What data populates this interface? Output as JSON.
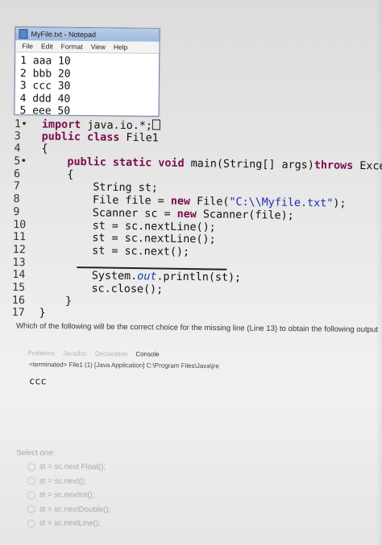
{
  "notepad": {
    "title": "MyFile.txt - Notepad",
    "menu": [
      "File",
      "Edit",
      "Format",
      "View",
      "Help"
    ],
    "lines": [
      "1 aaa 10",
      "2 bbb 20",
      "3 ccc 30",
      "4 ddd 40",
      "5 eee 50"
    ]
  },
  "editor": {
    "lines": [
      {
        "n": "1•",
        "parts": [
          {
            "t": "import",
            "c": "kw"
          },
          {
            "t": " java.io.*;"
          }
        ]
      },
      {
        "n": "3",
        "parts": [
          {
            "t": "public",
            "c": "kw"
          },
          {
            "t": " "
          },
          {
            "t": "class",
            "c": "kw"
          },
          {
            "t": " File1"
          }
        ]
      },
      {
        "n": "4",
        "parts": [
          {
            "t": "{"
          }
        ]
      },
      {
        "n": "5•",
        "parts": [
          {
            "t": "    "
          },
          {
            "t": "public",
            "c": "kw"
          },
          {
            "t": " "
          },
          {
            "t": "static",
            "c": "kw"
          },
          {
            "t": " "
          },
          {
            "t": "void",
            "c": "kw"
          },
          {
            "t": " main(String[] args)"
          },
          {
            "t": "throws",
            "c": "kw"
          },
          {
            "t": " Exception"
          }
        ]
      },
      {
        "n": "6",
        "parts": [
          {
            "t": "    {"
          }
        ]
      },
      {
        "n": "7",
        "parts": [
          {
            "t": "        String st;"
          }
        ]
      },
      {
        "n": "8",
        "parts": [
          {
            "t": "        File file = "
          },
          {
            "t": "new",
            "c": "kw"
          },
          {
            "t": " File("
          },
          {
            "t": "\"C:\\\\Myfile.txt\"",
            "c": "str"
          },
          {
            "t": ");"
          }
        ]
      },
      {
        "n": "9",
        "parts": [
          {
            "t": "        Scanner sc = "
          },
          {
            "t": "new",
            "c": "kw"
          },
          {
            "t": " Scanner(file);"
          }
        ]
      },
      {
        "n": "10",
        "parts": [
          {
            "t": "        st = sc.nextLine();"
          }
        ]
      },
      {
        "n": "11",
        "parts": [
          {
            "t": "        st = sc.nextLine();"
          }
        ]
      },
      {
        "n": "12",
        "parts": [
          {
            "t": "        st = sc.next();"
          }
        ]
      },
      {
        "n": "13",
        "parts": [],
        "missing": true
      },
      {
        "n": "14",
        "parts": [
          {
            "t": "        System."
          },
          {
            "t": "out",
            "c": "field"
          },
          {
            "t": ".println(st);"
          }
        ]
      },
      {
        "n": "15",
        "parts": [
          {
            "t": "        sc.close();"
          }
        ]
      },
      {
        "n": "16",
        "parts": [
          {
            "t": "    }"
          }
        ]
      },
      {
        "n": "17",
        "parts": [
          {
            "t": "}"
          }
        ]
      }
    ]
  },
  "question": "Which of the following will be the correct choice for the missing line (Line 13) to obtain the following output",
  "console": {
    "tabs": [
      "Problems",
      "Javadoc",
      "Declaration",
      "Console"
    ],
    "active_tab": "Console",
    "status": "<terminated> File1 (1) [Java Application] C:\\Program Files\\Java\\jre",
    "output": "ccc"
  },
  "answers": {
    "label": "Select one:",
    "options": [
      "st = sc.next Float();",
      "st = sc.next();",
      "st = sc.nextInt();",
      "st = sc.nextDouble();",
      "st = sc.nextLine();"
    ]
  }
}
